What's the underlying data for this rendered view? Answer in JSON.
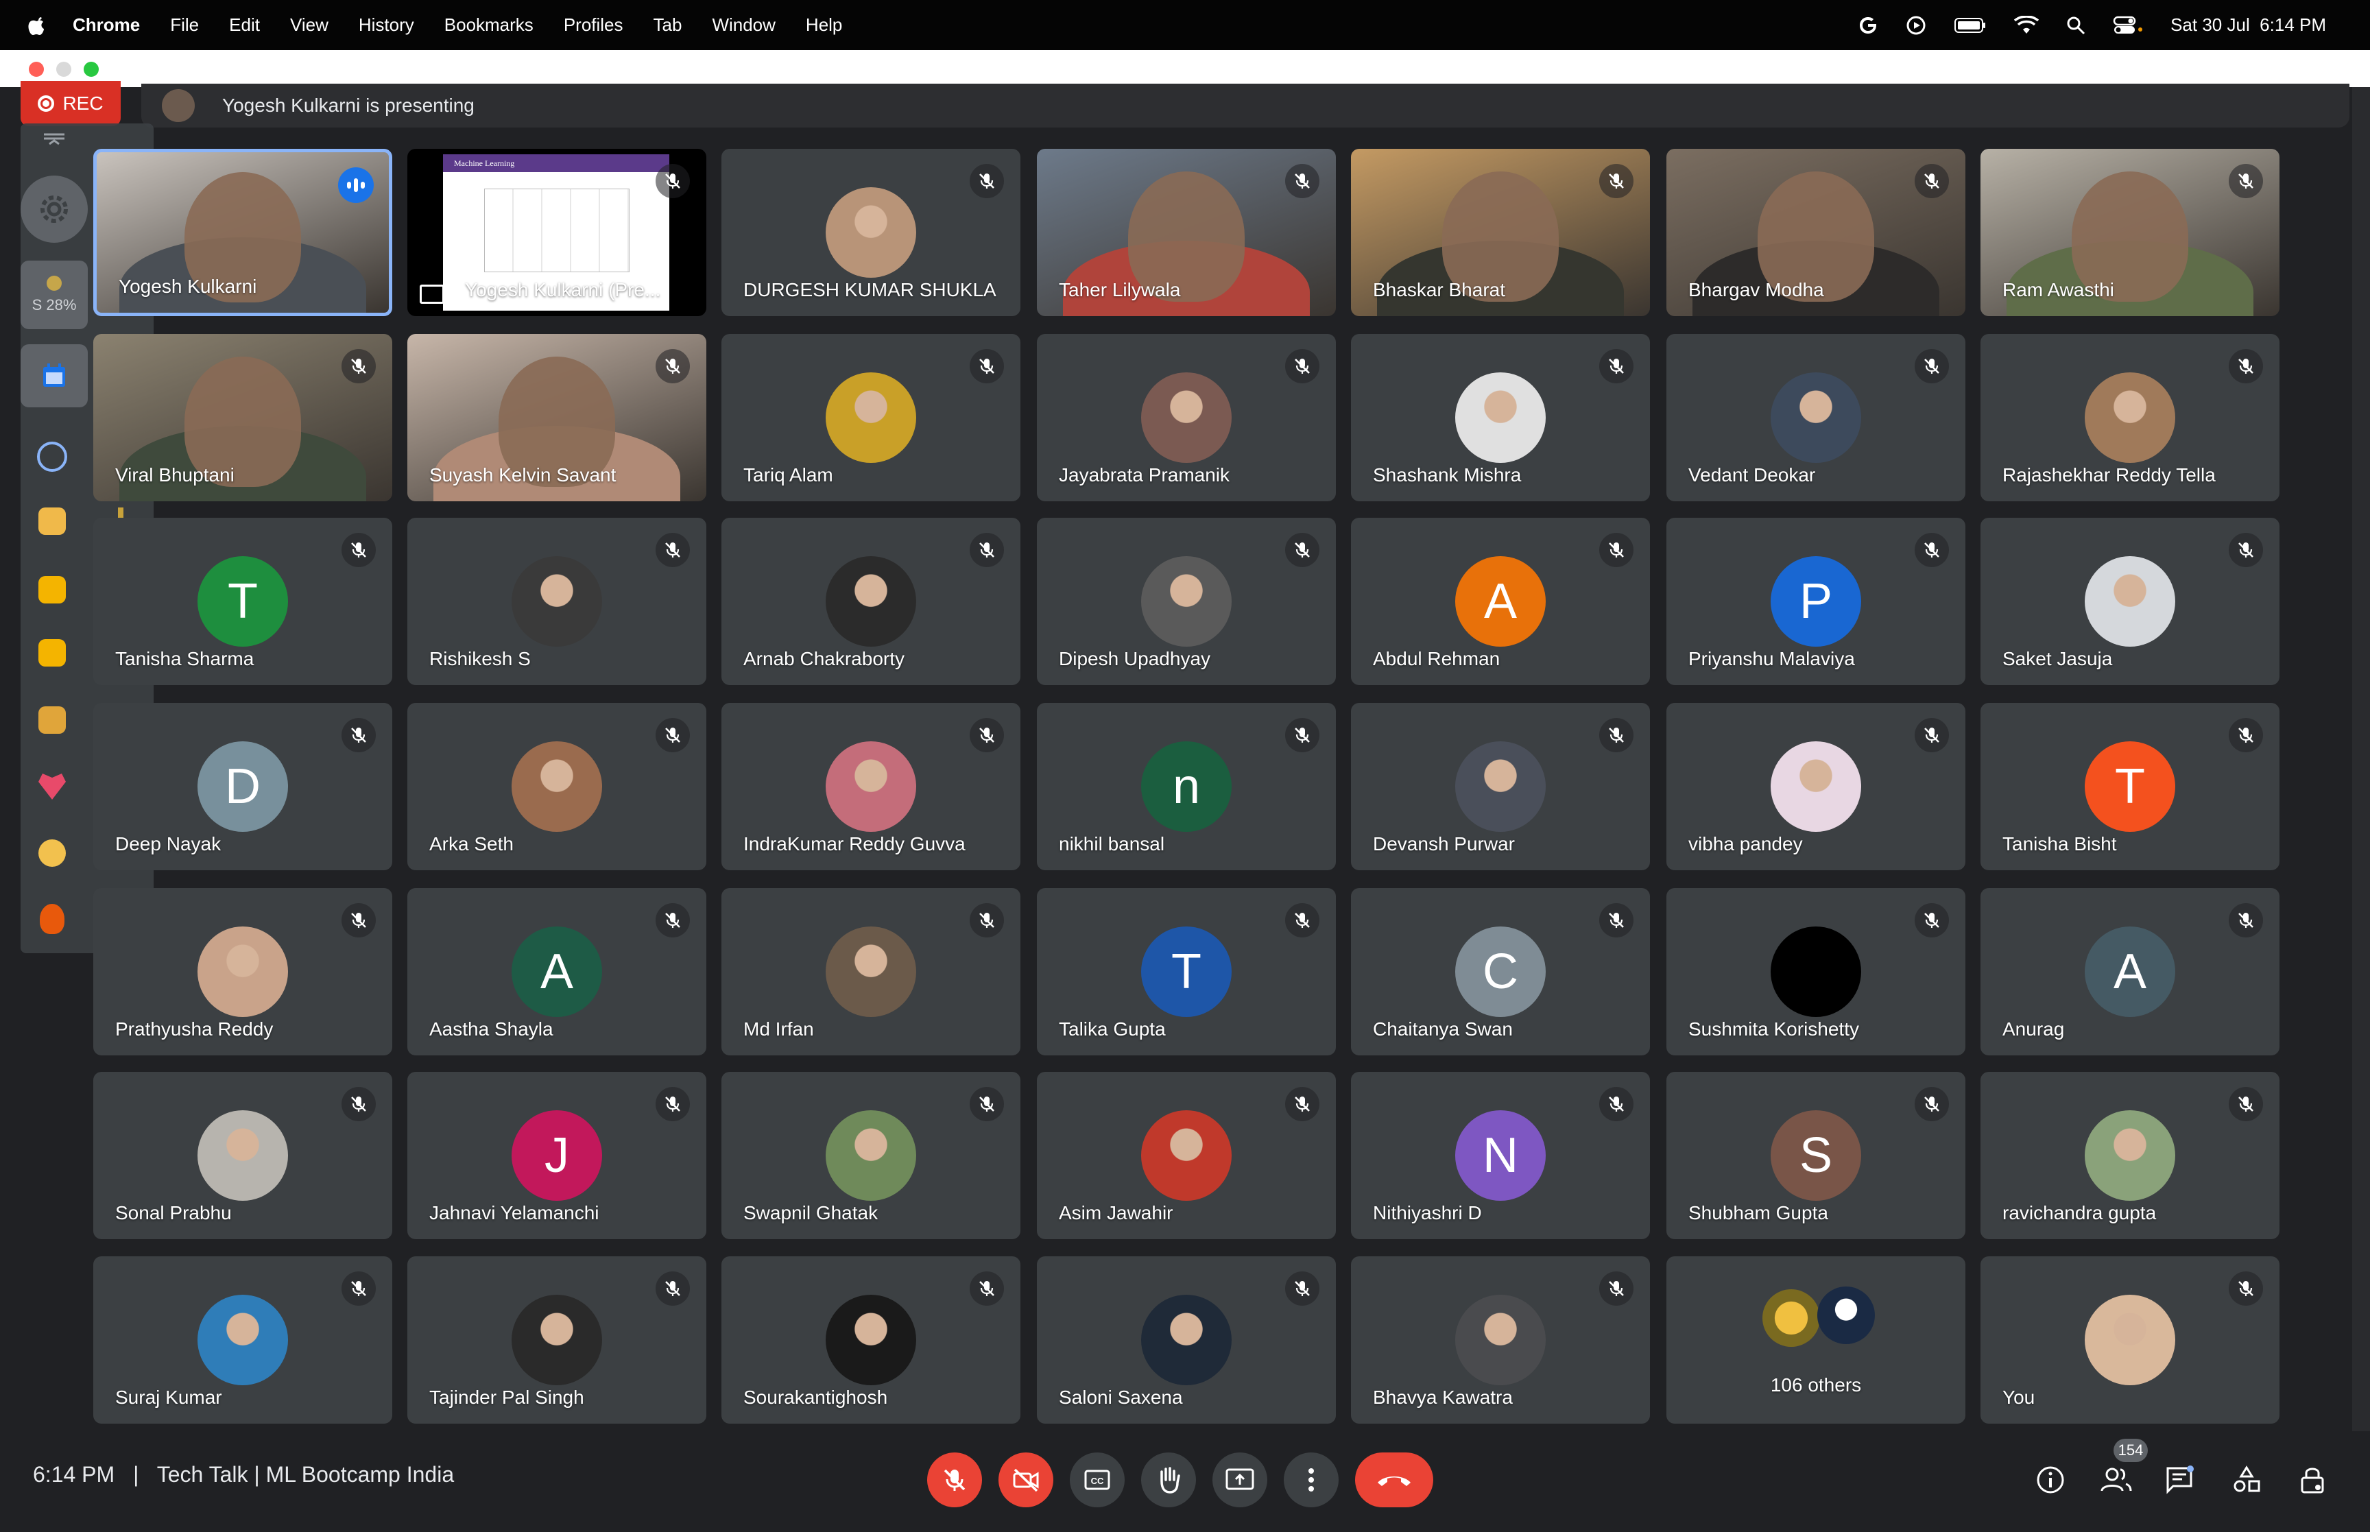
{
  "menubar": {
    "app_name": "Chrome",
    "menus": [
      "File",
      "Edit",
      "View",
      "History",
      "Bookmarks",
      "Profiles",
      "Tab",
      "Window",
      "Help"
    ],
    "datetime": "Sat 30 Jul  6:14 PM"
  },
  "meeting": {
    "rec_label": "REC",
    "presenting_text": "Yogesh Kulkarni is presenting",
    "side_percent": "S 28%",
    "time": "6:14 PM",
    "separator": "|",
    "title": "Tech Talk | ML Bootcamp India",
    "people_count": "154"
  },
  "colors": {
    "background": "#202124",
    "tile": "#3c4043",
    "danger": "#ea4335",
    "active_border": "#8ab4f8"
  },
  "tiles": [
    {
      "name": "Yogesh Kulkarni",
      "type": "video",
      "speaking": true,
      "tint": "#c9c3bd",
      "shirt": "#4a4f55"
    },
    {
      "name": "Yogesh Kulkarni (Pre...",
      "type": "screen",
      "slide_title": "Machine Learning",
      "tint": "#000000"
    },
    {
      "name": "DURGESH KUMAR SHUKLA",
      "type": "photo",
      "color": "#b89478"
    },
    {
      "name": "Taher Lilywala",
      "type": "video",
      "tint": "#6d7a8a",
      "shirt": "#b0443b"
    },
    {
      "name": "Bhaskar Bharat",
      "type": "video",
      "tint": "#c49a63",
      "shirt": "#35362f"
    },
    {
      "name": "Bhargav Modha",
      "type": "video",
      "tint": "#7b6e61",
      "shirt": "#2d2b2a"
    },
    {
      "name": "Ram Awasthi",
      "type": "video",
      "tint": "#b7b1a6",
      "shirt": "#5f6d49"
    },
    {
      "name": "Viral Bhuptani",
      "type": "video",
      "tint": "#8b8270",
      "shirt": "#3f4a3c"
    },
    {
      "name": "Suyash Kelvin Savant",
      "type": "video",
      "tint": "#c7b6a9",
      "shirt": "#b08a76"
    },
    {
      "name": "Tariq Alam",
      "type": "photo",
      "color": "#c9a028"
    },
    {
      "name": "Jayabrata Pramanik",
      "type": "photo",
      "color": "#7b5a52"
    },
    {
      "name": "Shashank Mishra",
      "type": "photo",
      "color": "#e0e0e0"
    },
    {
      "name": "Vedant Deokar",
      "type": "photo",
      "color": "#3d4a5c"
    },
    {
      "name": "Rajashekhar Reddy Tella",
      "type": "photo",
      "color": "#a07a5a"
    },
    {
      "name": "Tanisha Sharma",
      "type": "letter",
      "letter": "T",
      "color": "#1e8e3e"
    },
    {
      "name": "Rishikesh S",
      "type": "photo",
      "color": "#3a3a3a"
    },
    {
      "name": "Arnab Chakraborty",
      "type": "photo",
      "color": "#2b2b2b"
    },
    {
      "name": "Dipesh Upadhyay",
      "type": "photo",
      "color": "#5a5a5a"
    },
    {
      "name": "Abdul Rehman",
      "type": "letter",
      "letter": "A",
      "color": "#e8710a"
    },
    {
      "name": "Priyanshu Malaviya",
      "type": "letter",
      "letter": "P",
      "color": "#1967d2"
    },
    {
      "name": "Saket Jasuja",
      "type": "photo",
      "color": "#d5d8dc"
    },
    {
      "name": "Deep Nayak",
      "type": "letter",
      "letter": "D",
      "color": "#78909c"
    },
    {
      "name": "Arka Seth",
      "type": "photo",
      "color": "#9a6b4e"
    },
    {
      "name": "IndraKumar Reddy Guvva",
      "type": "photo",
      "color": "#c46d7a"
    },
    {
      "name": "nikhil bansal",
      "type": "letter",
      "letter": "n",
      "color": "#1b5e3f"
    },
    {
      "name": "Devansh Purwar",
      "type": "photo",
      "color": "#4a4f5a"
    },
    {
      "name": "vibha pandey",
      "type": "photo",
      "color": "#e8d7e3"
    },
    {
      "name": "Tanisha Bisht",
      "type": "letter",
      "letter": "T",
      "color": "#f4511e"
    },
    {
      "name": "Prathyusha Reddy",
      "type": "photo",
      "color": "#c9a38a"
    },
    {
      "name": "Aastha Shayla",
      "type": "letter",
      "letter": "A",
      "color": "#1e5b46"
    },
    {
      "name": "Md Irfan",
      "type": "photo",
      "color": "#6b5a4a"
    },
    {
      "name": "Talika Gupta",
      "type": "letter",
      "letter": "T",
      "color": "#1e56a8"
    },
    {
      "name": "Chaitanya Swan",
      "type": "letter",
      "letter": "C",
      "color": "#7f8c95"
    },
    {
      "name": "Sushmita Korishetty",
      "type": "photo",
      "color": "#000000"
    },
    {
      "name": "Anurag",
      "type": "letter",
      "letter": "A",
      "color": "#455a64"
    },
    {
      "name": "Sonal Prabhu",
      "type": "photo",
      "color": "#b7b4ae"
    },
    {
      "name": "Jahnavi Yelamanchi",
      "type": "letter",
      "letter": "J",
      "color": "#c2185b"
    },
    {
      "name": "Swapnil Ghatak",
      "type": "photo",
      "color": "#6f8a5a"
    },
    {
      "name": "Asim Jawahir",
      "type": "photo",
      "color": "#c0392b"
    },
    {
      "name": "Nithiyashri D",
      "type": "letter",
      "letter": "N",
      "color": "#7e57c2"
    },
    {
      "name": "Shubham Gupta",
      "type": "letter",
      "letter": "S",
      "color": "#795548"
    },
    {
      "name": "ravichandra gupta",
      "type": "photo",
      "color": "#8aa27a"
    },
    {
      "name": "Suraj Kumar",
      "type": "photo",
      "color": "#2f7db8"
    },
    {
      "name": "Tajinder Pal Singh",
      "type": "photo",
      "color": "#2a2a2a"
    },
    {
      "name": "Sourakantighosh",
      "type": "photo",
      "color": "#1a1a1a"
    },
    {
      "name": "Saloni Saxena",
      "type": "photo",
      "color": "#1f2a38"
    },
    {
      "name": "Bhavya Kawatra",
      "type": "photo",
      "color": "#4a4b4e"
    },
    {
      "name": "106 others",
      "type": "others"
    },
    {
      "name": "You",
      "type": "photo",
      "color": "#d9b89b",
      "self": true
    }
  ],
  "icons": {
    "mute": "mic-off-icon",
    "cam": "camera-off-icon",
    "captions": "captions-icon",
    "hand": "raise-hand-icon",
    "present": "present-icon",
    "more": "more-options-icon",
    "end": "end-call-icon",
    "info": "info-icon",
    "people": "people-icon",
    "chat": "chat-icon",
    "activities": "activities-icon",
    "host": "host-controls-icon"
  }
}
